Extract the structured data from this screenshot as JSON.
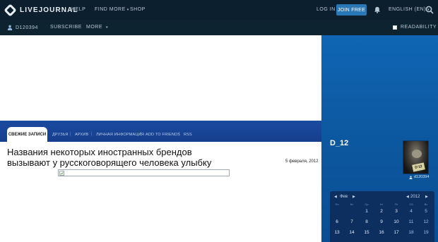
{
  "topbar": {
    "logo_text": "LIVEJOURNAL",
    "help": "HELP",
    "find_more": "FIND MORE",
    "shop": "SHOP",
    "login": "LOG IN",
    "join": "JOIN FREE",
    "language": "ENGLISH (EN)"
  },
  "subbar": {
    "username": "D120394",
    "subscribe": "SUBSCRIBE",
    "more": "MORE",
    "readability": "READABILITY"
  },
  "tabs": {
    "active": "СВЕЖИЕ ЗАПИСИ",
    "friends": "ДРУЗЬЯ",
    "archive": "АРХИВ",
    "profile": "ЛИЧНАЯ ИНФОРМАЦИЯ",
    "add_friends": "ADD TO FRIENDS",
    "rss": "RSS"
  },
  "post": {
    "title": "Названия некоторых иностранных брендов вызывают у русскоговорящего человека улыбку",
    "date": "5 февраля, 2012"
  },
  "sidebar": {
    "heading": "D_12",
    "avatar_badge": "D'12",
    "avatar_caption": "d120394"
  },
  "calendar": {
    "month": "Фев",
    "year": "2012",
    "weekdays": [
      "Пн",
      "Вт",
      "Ср",
      "Чт",
      "Пт",
      "Сб",
      "Вс"
    ],
    "rows": [
      [
        "",
        "",
        "1",
        "2",
        "3",
        "4",
        "5"
      ],
      [
        "6",
        "7",
        "8",
        "9",
        "10",
        "11",
        "12"
      ],
      [
        "13",
        "14",
        "15",
        "16",
        "17",
        "18",
        "19"
      ]
    ]
  },
  "colors": {
    "topbar_bg": "#0c1f2e",
    "join_button": "#2a77b5",
    "panel_blue": "#0f66b4",
    "band_blue": "#1b4aa0"
  }
}
